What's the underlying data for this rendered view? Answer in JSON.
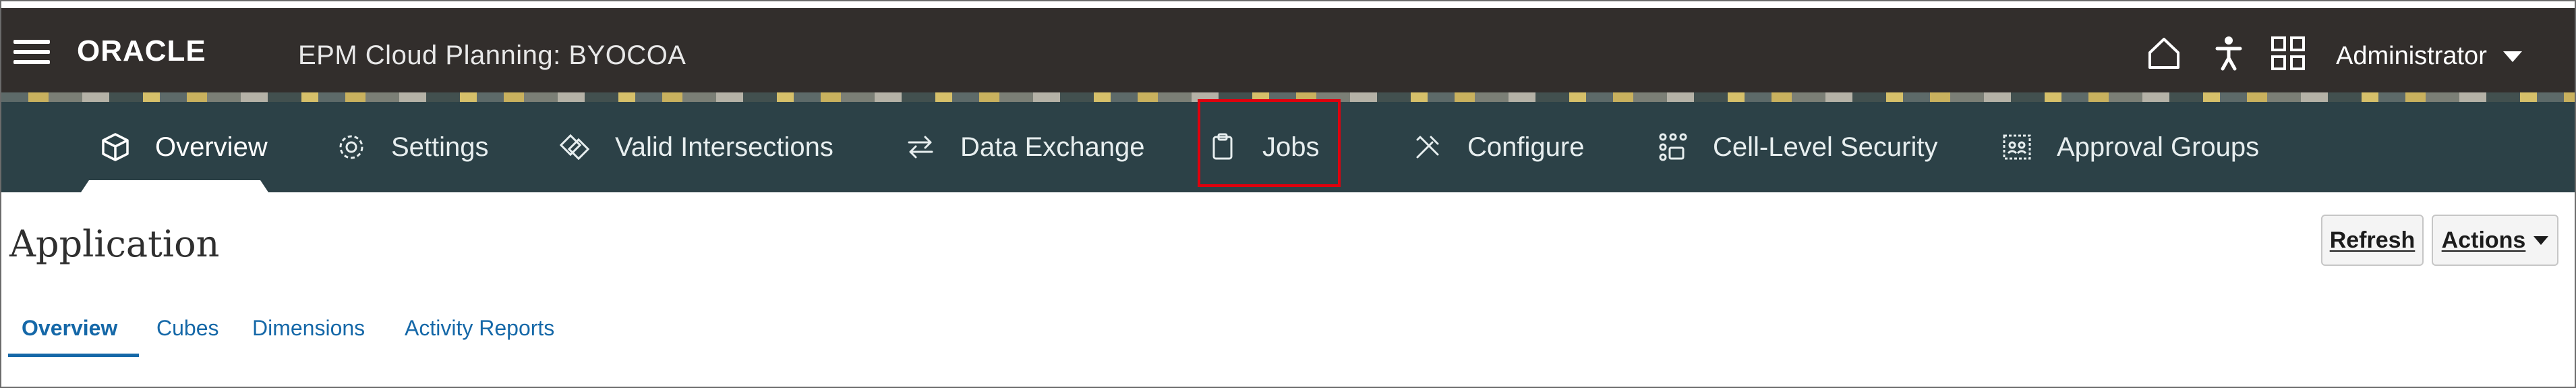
{
  "header": {
    "brand": "ORACLE",
    "app_title": "EPM Cloud Planning:  BYOCOA",
    "user": "Administrator",
    "icons": [
      "menu-icon",
      "home-icon",
      "accessibility-icon",
      "navigator-grid-icon"
    ]
  },
  "nav": {
    "items": [
      {
        "label": "Overview",
        "icon": "cube-icon",
        "active": true
      },
      {
        "label": "Settings",
        "icon": "gear-icon"
      },
      {
        "label": "Valid Intersections",
        "icon": "intersect-icon"
      },
      {
        "label": "Data Exchange",
        "icon": "exchange-arrows-icon"
      },
      {
        "label": "Jobs",
        "icon": "clipboard-icon",
        "highlighted": true
      },
      {
        "label": "Configure",
        "icon": "tools-icon"
      },
      {
        "label": "Cell-Level Security",
        "icon": "cell-security-icon"
      },
      {
        "label": "Approval Groups",
        "icon": "approval-groups-icon"
      }
    ]
  },
  "page": {
    "title": "Application",
    "buttons": {
      "refresh": "Refresh",
      "actions": "Actions"
    },
    "tabs": [
      {
        "label": "Overview",
        "active": true
      },
      {
        "label": "Cubes"
      },
      {
        "label": "Dimensions"
      },
      {
        "label": "Activity Reports"
      }
    ]
  },
  "colors": {
    "header_bg": "#322e2c",
    "nav_bg": "#2c4147",
    "highlight": "#e0000d",
    "link": "#1568a8"
  }
}
